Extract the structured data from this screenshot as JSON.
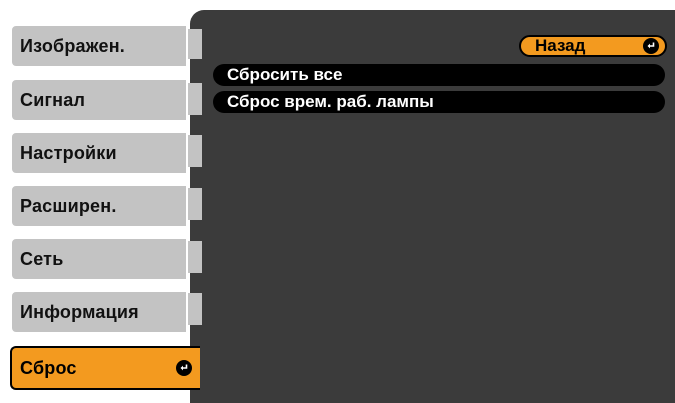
{
  "sidebar": {
    "items": [
      {
        "label": "Изображен."
      },
      {
        "label": "Сигнал"
      },
      {
        "label": "Настройки"
      },
      {
        "label": "Расширен."
      },
      {
        "label": "Сеть"
      },
      {
        "label": "Информация"
      },
      {
        "label": "Сброс",
        "selected": true,
        "icon": "enter-icon"
      }
    ]
  },
  "main": {
    "back_label": "Назад",
    "back_icon": "enter-icon",
    "items": [
      {
        "label": "Сбросить все"
      },
      {
        "label": "Сброс врем. раб. лампы"
      }
    ]
  },
  "colors": {
    "accent": "#f39a1f",
    "tab_inactive": "#c3c3c3",
    "panel": "#3b3b3b",
    "item_bg": "#000000"
  }
}
